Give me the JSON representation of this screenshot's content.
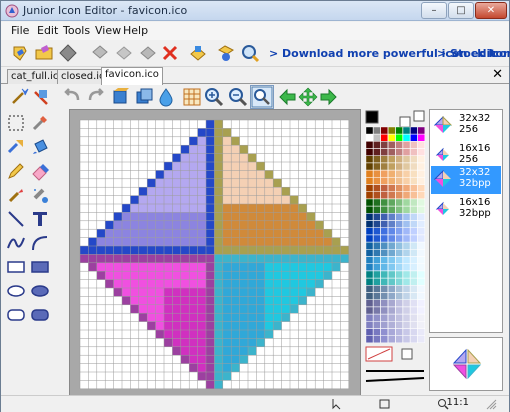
{
  "window": {
    "title": "Junior Icon Editor - favicon.ico",
    "minimize": "–",
    "maximize": "□",
    "close": "✕"
  },
  "menu": [
    {
      "label": "File"
    },
    {
      "label": "Edit"
    },
    {
      "label": "Tools"
    },
    {
      "label": "View"
    },
    {
      "label": "Help"
    }
  ],
  "links": {
    "download": "> Download more powerful icon editor",
    "stock": "> Stock Icons"
  },
  "tabs": [
    {
      "label": "cat_full.ico"
    },
    {
      "label": "closed.ico"
    },
    {
      "label": "favicon.ico"
    }
  ],
  "tabs_close": "✕",
  "images": [
    {
      "size": "32x32",
      "depth": "256"
    },
    {
      "size": "16x16",
      "depth": "256"
    },
    {
      "size": "32x32",
      "depth": "32bpp"
    },
    {
      "size": "16x16",
      "depth": "32bpp"
    }
  ],
  "status": {
    "zoom": "11:1"
  },
  "icon_names": {
    "toolbar1": [
      "new-icon",
      "open-icon",
      "save-icon",
      "cut-icon",
      "copy-icon",
      "paste-icon",
      "delete-icon",
      "import-icon",
      "help-icon",
      "search-icon"
    ],
    "toolbar2": [
      "wand-icon",
      "clear-icon",
      "undo-icon",
      "redo-icon",
      "frame-icon",
      "frames-icon",
      "drop-icon",
      "grid-icon",
      "zoom-in-icon",
      "zoom-out-icon",
      "zoom-fit-icon",
      "arrow-left-icon",
      "arrow-move-icon",
      "arrow-right-icon"
    ],
    "tools": [
      "select-icon",
      "picker-icon",
      "move-icon",
      "fill-icon",
      "pencil-icon",
      "eraser-icon",
      "brush-icon",
      "spray-icon",
      "line-icon",
      "text-icon",
      "curve-icon",
      "arc-icon",
      "rect-icon",
      "filled-rect-icon",
      "ellipse-icon",
      "filled-ellipse-icon",
      "round-rect-icon",
      "filled-round-rect-icon"
    ]
  },
  "colors": {
    "blue": "#2448c8",
    "lavender": "#b4a8f0",
    "tan": "#f4d0b4",
    "orange": "#d08a3a",
    "olive": "#a8a050",
    "magenta": "#d030c0",
    "pink": "#f050e0",
    "cyan": "#20c8e0",
    "teal": "#3cb4cc",
    "purple": "#9c40a0"
  }
}
